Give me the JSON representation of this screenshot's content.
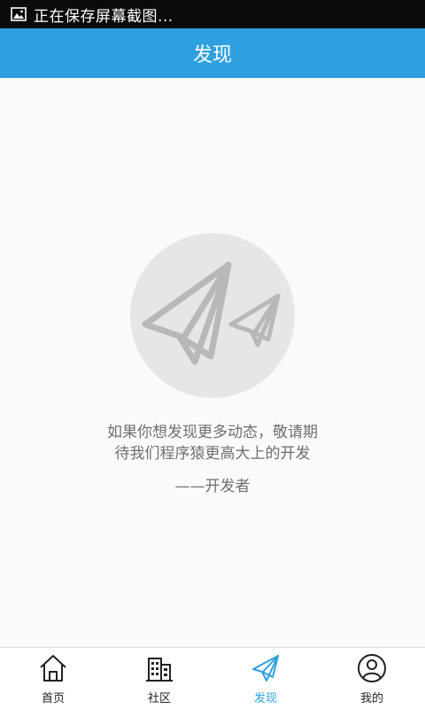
{
  "status_bar": {
    "notification_icon": "image-icon",
    "text": "正在保存屏幕截图..."
  },
  "header": {
    "title": "发现"
  },
  "main": {
    "illustration_icon": "paper-plane-icon",
    "message_line1": "如果你想发现更多动态，敬请期",
    "message_line2": "待我们程序猿更高大上的开发",
    "signature": "——开发者"
  },
  "tabs": [
    {
      "label": "首页",
      "icon": "home-icon",
      "active": false
    },
    {
      "label": "社区",
      "icon": "building-icon",
      "active": false
    },
    {
      "label": "发现",
      "icon": "paper-plane-icon",
      "active": true
    },
    {
      "label": "我的",
      "icon": "user-icon",
      "active": false
    }
  ],
  "colors": {
    "accent": "#2fa0df",
    "status_bar": "#0b0b0b",
    "background": "#fafafa",
    "illustration_circle": "#e6e6e6",
    "illustration_plane": "#b8b8b8",
    "text_gray": "#6f6f6f"
  }
}
